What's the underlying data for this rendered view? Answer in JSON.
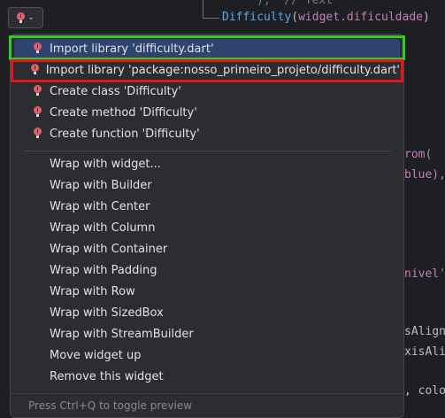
{
  "editor": {
    "line0": "),  // Text",
    "line1_class": "Difficulty",
    "line1_open": "(",
    "line1_arg": "widget.dificuldade",
    "line1_close": ")",
    "frag_rom": "rom(",
    "frag_blue": "blue),",
    "frag_nivel": "nivel'",
    "frag_salign": "sAlign",
    "frag_xisali": "xisAli",
    "frag_colo": ", colo"
  },
  "intention_button": {
    "icon": "red-bulb-icon"
  },
  "menu": {
    "items": [
      {
        "label": "Import library 'difficulty.dart'",
        "icon": "red-bulb-icon"
      },
      {
        "label": "Import library 'package:nosso_primeiro_projeto/difficulty.dart'",
        "icon": "red-bulb-icon"
      },
      {
        "label": "Create class 'Difficulty'",
        "icon": "red-bulb-icon"
      },
      {
        "label": "Create method 'Difficulty'",
        "icon": "red-bulb-icon"
      },
      {
        "label": "Create function 'Difficulty'",
        "icon": "red-bulb-icon"
      },
      {
        "label": "Wrap with widget..."
      },
      {
        "label": "Wrap with Builder"
      },
      {
        "label": "Wrap with Center"
      },
      {
        "label": "Wrap with Column"
      },
      {
        "label": "Wrap with Container"
      },
      {
        "label": "Wrap with Padding"
      },
      {
        "label": "Wrap with Row"
      },
      {
        "label": "Wrap with SizedBox"
      },
      {
        "label": "Wrap with StreamBuilder"
      },
      {
        "label": "Move widget up"
      },
      {
        "label": "Remove this widget"
      }
    ],
    "footer": "Press Ctrl+Q to toggle preview"
  },
  "colors": {
    "highlight_green": "#35c928",
    "highlight_red": "#e0161c",
    "selection": "#2e436e"
  }
}
